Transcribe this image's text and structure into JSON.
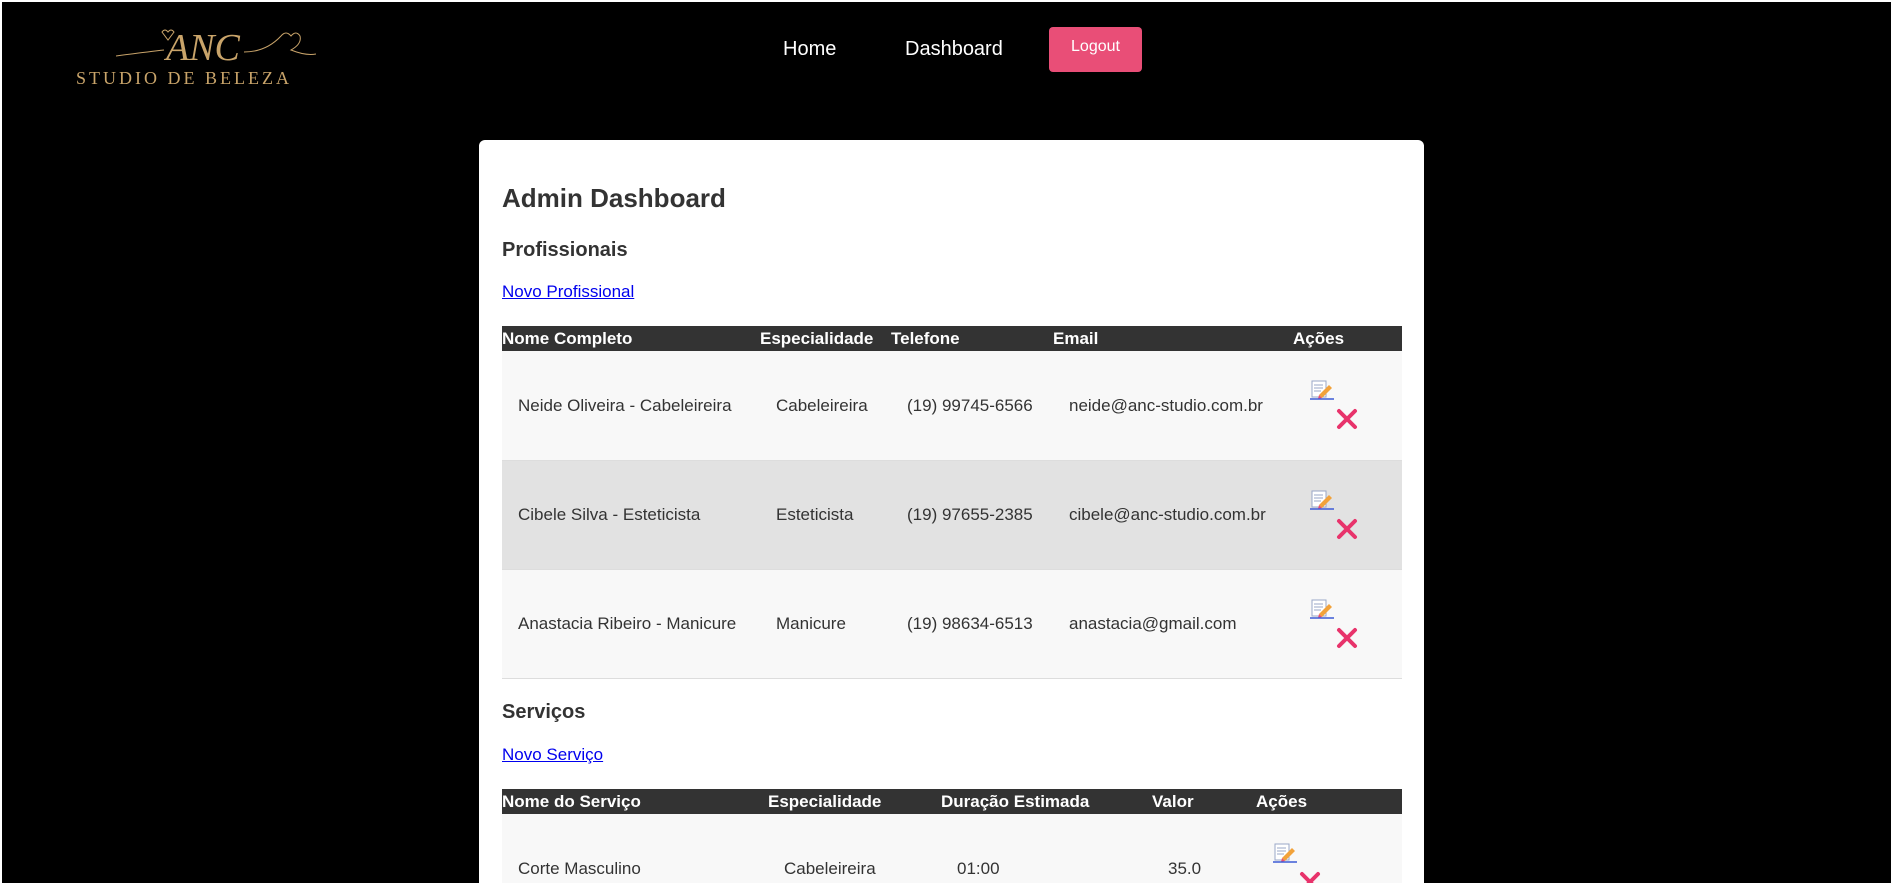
{
  "brand": {
    "logo_script": "ANC",
    "logo_text": "STUDIO DE BELEZA",
    "gold_color": "#c9a46a"
  },
  "nav": {
    "home_label": "Home",
    "dashboard_label": "Dashboard",
    "logout_label": "Logout",
    "logout_color": "#e94e77"
  },
  "page": {
    "title": "Admin Dashboard"
  },
  "professionals": {
    "heading": "Profissionais",
    "add_link": "Novo Profissional",
    "columns": [
      "Nome Completo",
      "Especialidade",
      "Telefone",
      "Email",
      "Ações"
    ],
    "rows": [
      {
        "name": "Neide Oliveira - Cabeleireira",
        "specialty": "Cabeleireira",
        "phone": "(19) 99745-6566",
        "email": "neide@anc-studio.com.br"
      },
      {
        "name": "Cibele Silva - Esteticista",
        "specialty": "Esteticista",
        "phone": "(19) 97655-2385",
        "email": "cibele@anc-studio.com.br"
      },
      {
        "name": "Anastacia Ribeiro - Manicure",
        "specialty": "Manicure",
        "phone": "(19) 98634-6513",
        "email": "anastacia@gmail.com"
      }
    ]
  },
  "services": {
    "heading": "Serviços",
    "add_link": "Novo Serviço",
    "columns": [
      "Nome do Serviço",
      "Especialidade",
      "Duração Estimada",
      "Valor",
      "Ações"
    ],
    "rows": [
      {
        "name": "Corte Masculino",
        "specialty": "Cabeleireira",
        "duration": "01:00",
        "price": "35.0"
      }
    ]
  },
  "icons": {
    "edit": "edit-icon",
    "delete": "delete-icon",
    "delete_color": "#e8336b"
  }
}
